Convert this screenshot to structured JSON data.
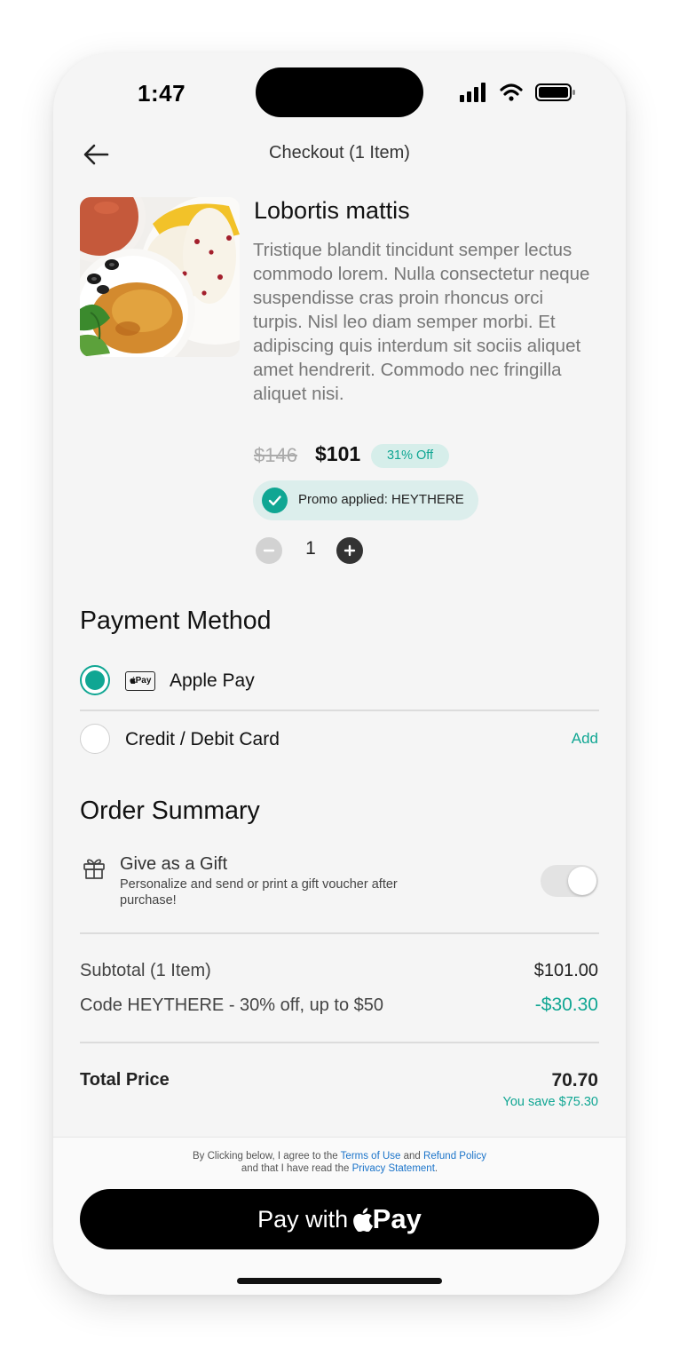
{
  "status_bar": {
    "time": "1:47"
  },
  "header": {
    "title": "Checkout (1 Item)"
  },
  "product": {
    "title": "Lobortis mattis",
    "description": "Tristique blandit tincidunt semper lectus commodo lorem. Nulla consectetur neque suspendisse cras proin rhoncus orci turpis. Nisl leo diam semper morbi. Et adipiscing quis interdum sit sociis aliquet amet hendrerit. Commodo nec fringilla aliquet nisi.",
    "old_price": "$146",
    "price": "$101",
    "discount_badge": "31% Off",
    "promo_text": "Promo applied: HEYTHERE",
    "quantity": "1"
  },
  "payment": {
    "title": "Payment Method",
    "options": [
      {
        "label": "Apple Pay",
        "selected": true,
        "mark": "Pay"
      },
      {
        "label": "Credit / Debit Card",
        "selected": false,
        "action": "Add"
      }
    ]
  },
  "summary": {
    "title": "Order Summary",
    "gift_title": "Give as a Gift",
    "gift_subtitle": "Personalize and send or print a gift voucher after purchase!",
    "subtotal_label": "Subtotal (1 Item)",
    "subtotal_value": "$101.00",
    "code_label": "Code HEYTHERE - 30% off, up to $50",
    "code_value": "-$30.30",
    "total_label": "Total Price",
    "total_value": "70.70",
    "savings": "You save $75.30"
  },
  "footer": {
    "legal_1": "By Clicking below, I agree to the",
    "terms_link": "Terms of Use",
    "legal_and": "and",
    "refund_link": "Refund Policy",
    "legal_2": "and that I have read the",
    "privacy_link": "Privacy Statement",
    "legal_end": ".",
    "pay_with": "Pay with",
    "pay": "Pay"
  },
  "colors": {
    "accent": "#10a693",
    "link": "#1a73c9",
    "button": "#000000"
  }
}
